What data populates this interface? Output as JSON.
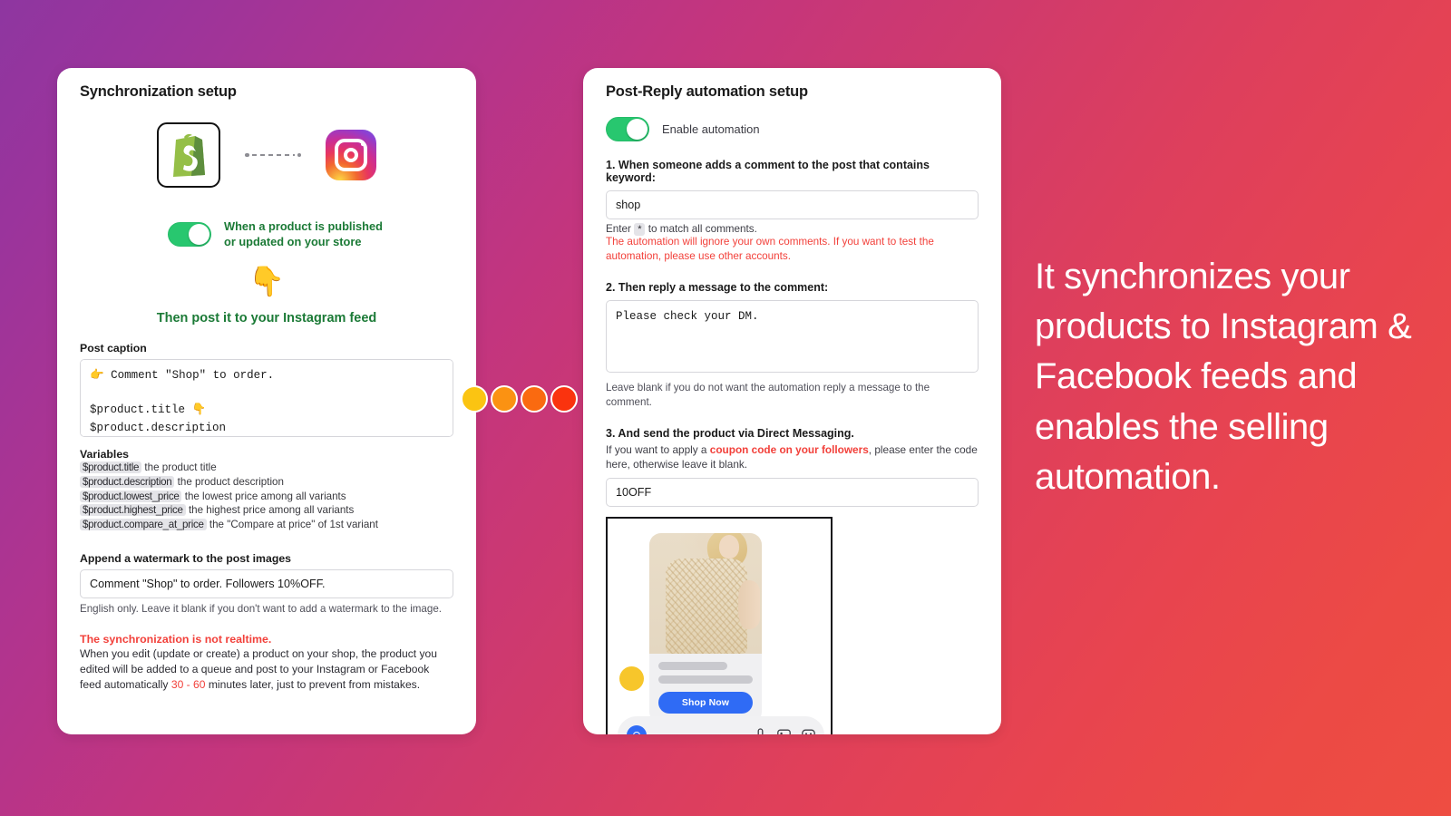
{
  "left_panel": {
    "title": "Synchronization setup",
    "icons": {
      "source": "shopify-icon",
      "connector": "dotted-line",
      "target": "instagram-icon"
    },
    "publish_toggle": {
      "state": "on",
      "label_line1": "When a product is published",
      "label_line2": "or updated on your store"
    },
    "hand_emoji": "👇",
    "then_post_text": "Then post it to your Instagram feed",
    "post_caption": {
      "label": "Post caption",
      "value": "👉 Comment \"Shop\" to order.\n\n$product.title 👇\n$product.description"
    },
    "variables": {
      "title": "Variables",
      "items": [
        {
          "code": "$product.title",
          "desc": "the product title"
        },
        {
          "code": "$product.description",
          "desc": "the product description"
        },
        {
          "code": "$product.lowest_price",
          "desc": "the lowest price among all variants"
        },
        {
          "code": "$product.highest_price",
          "desc": "the highest price among all variants"
        },
        {
          "code": "$product.compare_at_price",
          "desc": "the \"Compare at price\" of 1st variant"
        }
      ]
    },
    "watermark": {
      "label": "Append a watermark to the post images",
      "value": "Comment \"Shop\" to order. Followers 10%OFF.",
      "helper": "English only. Leave it blank if you don't want to add a watermark to the image."
    },
    "warning": {
      "title": "The synchronization is not realtime.",
      "body_part1": "When you edit (update or create) a product on your shop, the product you edited will be added to a queue and post to your Instagram or Facebook feed automatically ",
      "highlight": "30 - 60",
      "body_part2": " minutes later, just to prevent from mistakes."
    }
  },
  "right_panel": {
    "title": "Post-Reply automation setup",
    "enable_toggle": {
      "state": "on",
      "label": "Enable automation"
    },
    "step1": {
      "title": "1. When someone adds a comment to the post that contains keyword:",
      "input_value": "shop",
      "enter_prefix": "Enter",
      "enter_chip": "*",
      "enter_suffix": "to match all comments.",
      "red_note": "The automation will ignore your own comments. If you want to test the automation, please use other accounts."
    },
    "step2": {
      "title": "2. Then reply a message to the comment:",
      "textarea_value": "Please check your DM.",
      "helper": "Leave blank if you do not want the automation reply a message to the comment."
    },
    "step3": {
      "title": "3. And send the product via Direct Messaging.",
      "note_part1": "If you want to apply a ",
      "note_highlight": "coupon code on your followers",
      "note_part2": ", please enter the code here, otherwise leave it blank.",
      "coupon_value": "10OFF"
    },
    "phone_preview": {
      "shop_button_label": "Shop Now",
      "icons": [
        "camera-icon",
        "microphone-icon",
        "image-icon",
        "sticker-icon"
      ]
    }
  },
  "connector_dots": [
    {
      "color": "#fbc412"
    },
    {
      "color": "#fb9212"
    },
    {
      "color": "#fa6a10"
    },
    {
      "color": "#fa330e"
    }
  ],
  "promo": {
    "text": "It synchronizes your products to Instagram & Facebook feeds and enables the selling automation."
  },
  "theme": {
    "gradient_start": "#8e36a0",
    "gradient_end": "#ee4d42",
    "toggle_on": "#28c76f",
    "green_text": "#1b7a36",
    "red_text": "#f2403a",
    "blue_button": "#2f6bf5"
  }
}
